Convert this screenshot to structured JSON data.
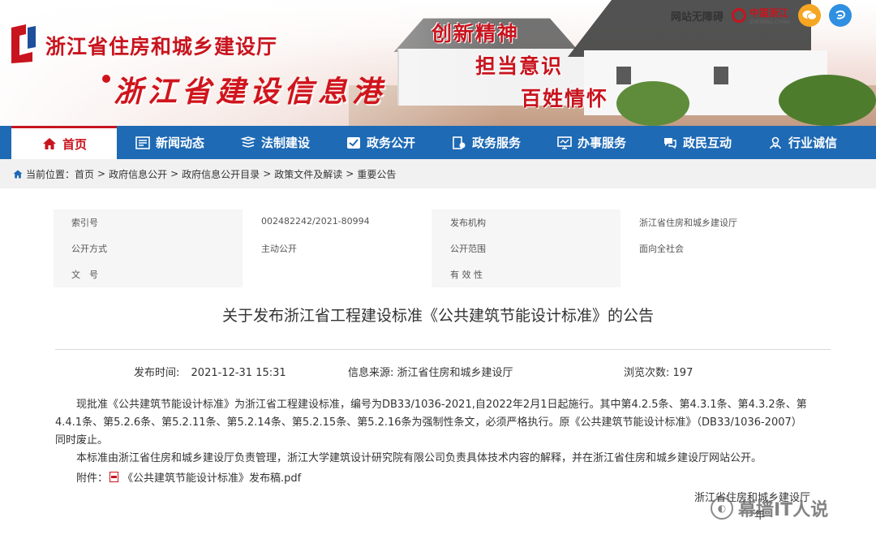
{
  "header": {
    "site_title": "浙江省住房和城乡建设厅",
    "site_subtitle": "浙江省建设信息港",
    "slogans": [
      "创新精神",
      "担当意识",
      "百姓情怀"
    ],
    "accessibility_link": "网站无障碍",
    "china_zhejiang_label": "中国浙江",
    "china_zhejiang_small": "ZHEJIANG.CHINA",
    "logo_icon": "zjjst-logo",
    "wechat_icon": "wechat-icon",
    "weibo_icon": "weibo-icon"
  },
  "nav": {
    "items": [
      {
        "label": "首页",
        "icon": "home-icon",
        "active": true
      },
      {
        "label": "新闻动态",
        "icon": "news-icon"
      },
      {
        "label": "法制建设",
        "icon": "law-icon"
      },
      {
        "label": "政务公开",
        "icon": "gov-open-icon"
      },
      {
        "label": "政务服务",
        "icon": "service-icon"
      },
      {
        "label": "办事服务",
        "icon": "affairs-icon"
      },
      {
        "label": "政民互动",
        "icon": "interaction-icon"
      },
      {
        "label": "行业诚信",
        "icon": "integrity-icon"
      }
    ]
  },
  "breadcrumb": {
    "prefix": "当前位置：",
    "items": [
      "首页",
      "政府信息公开",
      "政府信息公开目录",
      "政策文件及解读",
      "重要公告"
    ],
    "separator": ">"
  },
  "meta": {
    "index_label": "索引号",
    "index_value": "002482242/2021-80994",
    "publisher_label": "发布机构",
    "publisher_value": "浙江省住房和城乡建设厅",
    "open_method_label": "公开方式",
    "open_method_value": "主动公开",
    "open_scope_label": "公开范围",
    "open_scope_value": "面向全社会",
    "doc_no_label": "文　号",
    "doc_no_value": "",
    "validity_label": "有 效 性",
    "validity_value": ""
  },
  "article": {
    "title": "关于发布浙江省工程建设标准《公共建筑节能设计标准》的公告",
    "publish_time_label": "发布时间:",
    "publish_time": "2021-12-31 15:31",
    "source_label": "信息来源:",
    "source": "浙江省住房和城乡建设厅",
    "views_label": "浏览次数:",
    "views": "197",
    "paragraph1": "现批准《公共建筑节能设计标准》为浙江省工程建设标准，编号为DB33/1036-2021,自2022年2月1日起施行。其中第4.2.5条、第4.3.1条、第4.3.2条、第4.4.1条、第5.2.6条、第5.2.11条、第5.2.14条、第5.2.15条、第5.2.16条为强制性条文，必须严格执行。原《公共建筑节能设计标准》（DB33/1036-2007）同时废止。",
    "paragraph2": "本标准由浙江省住房和城乡建设厅负责管理，浙江大学建筑设计研究院有限公司负责具体技术内容的解释，并在浙江省住房和城乡建设厅网站公开。",
    "attachment_label": "附件：",
    "attachment_name": "《公共建筑节能设计标准》发布稿.pdf",
    "signer": "浙江省住房和城乡建设厅",
    "sign_date_partial": "年"
  },
  "watermark": {
    "text": "幕墙IT人说"
  },
  "colors": {
    "brand_red": "#c8141e",
    "nav_blue": "#1e6ab5"
  }
}
